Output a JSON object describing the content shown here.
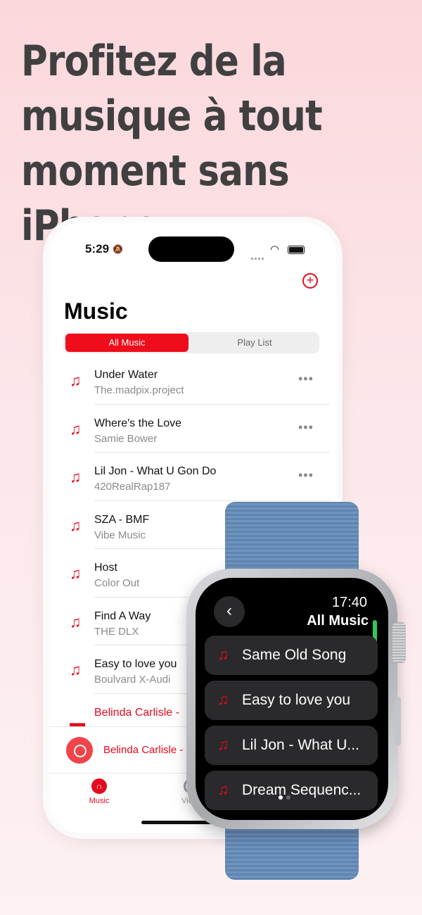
{
  "headline": "Profitez de la musique à tout moment sans iPhone",
  "phone": {
    "status_time": "5:29",
    "page_title": "Music",
    "segments": [
      "All Music",
      "Play List"
    ],
    "songs": [
      {
        "name": "Under Water",
        "artist": "The.madpix.project",
        "more": "•••"
      },
      {
        "name": "Where's the Love",
        "artist": "Samie Bower",
        "more": "•••"
      },
      {
        "name": "Lil Jon - What U Gon Do",
        "artist": "420RealRap187",
        "more": "•••"
      },
      {
        "name": "SZA - BMF",
        "artist": "Vibe Music",
        "more": ""
      },
      {
        "name": "Host",
        "artist": "Color Out",
        "more": ""
      },
      {
        "name": "Find A Way",
        "artist": "THE DLX",
        "more": ""
      },
      {
        "name": "Easy to love you",
        "artist": "Boulvard X-Audi",
        "more": ""
      },
      {
        "name": "Belinda Carlisle -",
        "artist": "",
        "more": ""
      }
    ],
    "now_playing": "Belinda Carlisle -",
    "tabs": [
      "Music",
      "Video"
    ]
  },
  "watch": {
    "time": "17:40",
    "title": "All Music",
    "items": [
      "Same Old Song",
      "Easy to love you",
      "Lil Jon - What U...",
      "Dream Sequenc..."
    ]
  },
  "colors": {
    "accent": "#e5091f",
    "segment_active": "#ef0c1b",
    "watch_band": "#6a8fba",
    "scroll": "#33c75a"
  },
  "icons": [
    "bell-slash-icon",
    "wifi-icon",
    "battery-icon",
    "add-circle-icon",
    "music-note-icon",
    "more-icon",
    "chevron-left-icon",
    "headphones-icon"
  ]
}
